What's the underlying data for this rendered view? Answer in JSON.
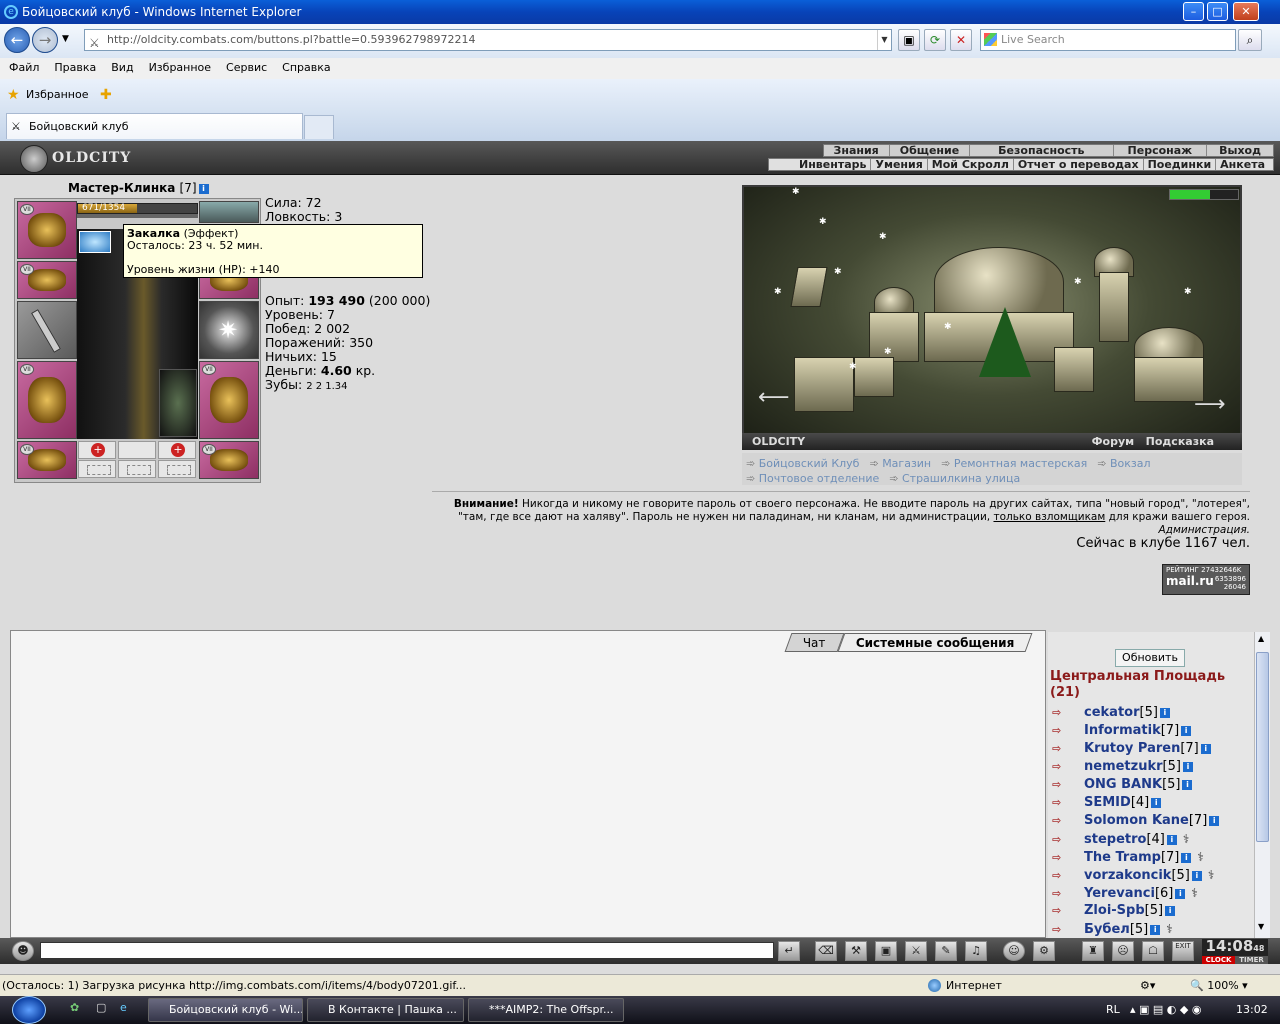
{
  "window": {
    "title": "Бойцовский клуб - Windows Internet Explorer"
  },
  "browser": {
    "address": "http://oldcity.combats.com/buttons.pl?battle=0.593962798972214",
    "search_placeholder": "Live Search",
    "menu": [
      "Файл",
      "Правка",
      "Вид",
      "Избранное",
      "Сервис",
      "Справка"
    ],
    "favorites_label": "Избранное",
    "tab_title": "Бойцовский клуб"
  },
  "game": {
    "logo": "OLDCITY",
    "top_menu": [
      "Знания",
      "Общение",
      "Безопасность",
      "Персонаж",
      "Выход"
    ],
    "sub_menu": [
      "Инвентарь",
      "Умения",
      "Мой Скролл",
      "Отчет о переводах",
      "Поединки",
      "Анкета"
    ],
    "character": {
      "name": "Мастер-Клинка",
      "level": "[7]",
      "hp_text": "671/1354",
      "hp_fraction": 0.496
    },
    "stats": [
      "Сила: 72",
      "Ловкость: 3"
    ],
    "stats2": [
      {
        "label": "Опыт: ",
        "bold": "193 490",
        "rest": " (200 000)"
      },
      {
        "label": "Уровень: 7",
        "bold": "",
        "rest": ""
      },
      {
        "label": "Побед: 2 002",
        "bold": "",
        "rest": ""
      },
      {
        "label": "Поражений: 350",
        "bold": "",
        "rest": ""
      },
      {
        "label": "Ничьих: 15",
        "bold": "",
        "rest": ""
      },
      {
        "label": "Деньги: ",
        "bold": "4.60",
        "rest": " кр."
      }
    ],
    "teeth": "Зубы: ",
    "teeth_values": "2  2  1.34",
    "tooltip": {
      "title": "Закалка",
      "type": " (Эффект)",
      "remaining": "Осталось: 23 ч. 52 мин.",
      "effect": "Уровень жизни (HP): +140"
    },
    "city": {
      "name": "OLDCITY",
      "forum": "Форум",
      "hint": "Подсказка",
      "links": [
        "Бойцовский Клуб",
        "Магазин",
        "Ремонтная мастерская",
        "Вокзал",
        "Почтовое отделение",
        "Страшилкина улица"
      ]
    },
    "warning": {
      "bold": "Внимание!",
      "text1": " Никогда и никому не говорите пароль от своего персонажа. Не вводите пароль на других сайтах, типа \"новый город\", \"лотерея\",",
      "text2": "\"там, где все дают на халяву\". Пароль не нужен ни паладинам, ни кланам, ни администрации, ",
      "link": "только взломщикам",
      "text3": " для кражи вашего героя."
    },
    "admin": "Администрация.",
    "online": "Сейчас в клубе 1167 чел.",
    "rating": {
      "label": "РЕЙТИНГ",
      "v1": "27432646K",
      "brand": "mail.ru",
      "v2": "6353896",
      "v3": "26046"
    },
    "chat_tabs": [
      "Чат",
      "Системные сообщения"
    ],
    "refresh": "Обновить",
    "location": "Центральная Площадь (21)",
    "users": [
      {
        "name": "cekator",
        "level": "[5]",
        "injury": false
      },
      {
        "name": "Informatik",
        "level": "[7]",
        "injury": false
      },
      {
        "name": "Krutoy Paren",
        "level": "[7]",
        "injury": false
      },
      {
        "name": "nemetzukr",
        "level": "[5]",
        "injury": false
      },
      {
        "name": "ONG BANK",
        "level": "[5]",
        "injury": false
      },
      {
        "name": "SEMID",
        "level": "[4]",
        "injury": false
      },
      {
        "name": "Solomon Kane",
        "level": "[7]",
        "injury": false
      },
      {
        "name": "stepetro",
        "level": "[4]",
        "injury": true
      },
      {
        "name": "The Tramp",
        "level": "[7]",
        "injury": true
      },
      {
        "name": "vorzakoncik",
        "level": "[5]",
        "injury": true
      },
      {
        "name": "Yerevanci",
        "level": "[6]",
        "injury": true
      },
      {
        "name": "Zloi-Spb",
        "level": "[5]",
        "injury": false
      },
      {
        "name": "Бубел",
        "level": "[5]",
        "injury": true
      }
    ],
    "clock": "14:08",
    "clock_sec": "48",
    "clock_label": "CLOCK",
    "timer_label": "TIMER",
    "exit": "EXIT"
  },
  "statusbar": {
    "text": "(Осталось: 1) Загрузка рисунка http://img.combats.com/i/items/4/body07201.gif...",
    "zone": "Интернет",
    "zoom": "100%"
  },
  "taskbar": {
    "items": [
      "Бойцовский клуб - Wi...",
      "В Контакте | Пашка ...",
      "***AIMP2: The Offspr..."
    ],
    "lang": "RL",
    "time": "13:02"
  }
}
